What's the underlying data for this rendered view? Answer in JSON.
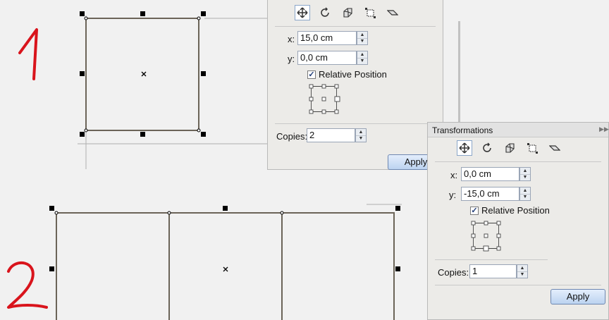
{
  "panel1": {
    "x_label": "x:",
    "x_value": "15,0 cm",
    "y_label": "y:",
    "y_value": "0,0 cm",
    "relative_position_label": "Relative Position",
    "relative_position_checked": true,
    "copies_label": "Copies:",
    "copies_value": "2",
    "apply_label": "Apply"
  },
  "panel2": {
    "title": "Transformations",
    "x_label": "x:",
    "x_value": "0,0 cm",
    "y_label": "y:",
    "y_value": "-15,0 cm",
    "relative_position_label": "Relative Position",
    "relative_position_checked": true,
    "copies_label": "Copies:",
    "copies_value": "1",
    "apply_label": "Apply"
  },
  "toolbar_icons": [
    "position-icon",
    "rotate-icon",
    "scale-icon",
    "size-icon",
    "skew-icon"
  ],
  "annotations": {
    "step1": "1",
    "step2": "2",
    "color": "#d9141c"
  },
  "colors": {
    "panel_bg": "#ecebe8",
    "annotation_red": "#d9141c",
    "button_border": "#6e87b0"
  }
}
